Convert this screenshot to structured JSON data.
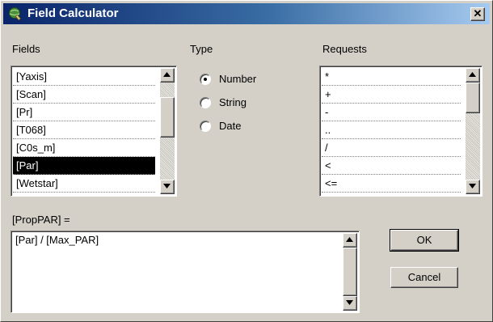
{
  "window": {
    "title": "Field Calculator",
    "title_icon": "globe-icon",
    "close_glyph": "✕"
  },
  "fields": {
    "label": "Fields",
    "items": [
      "[Yaxis]",
      "[Scan]",
      "[Pr]",
      "[T068]",
      "[C0s_m]",
      "[Par]",
      "[Wetstar]"
    ],
    "selected": "[Par]"
  },
  "type": {
    "label": "Type",
    "options": [
      "Number",
      "String",
      "Date"
    ],
    "selected": "Number"
  },
  "requests": {
    "label": "Requests",
    "items": [
      "*",
      "+",
      "-",
      "..",
      "/",
      "<",
      "<="
    ]
  },
  "expression": {
    "target_label": "[PropPAR] =",
    "value": "[Par] / [Max_PAR]"
  },
  "buttons": {
    "ok": "OK",
    "cancel": "Cancel"
  },
  "colors": {
    "titlebar_start": "#0a246a",
    "titlebar_end": "#a6caf0",
    "face": "#d4d0c8"
  }
}
